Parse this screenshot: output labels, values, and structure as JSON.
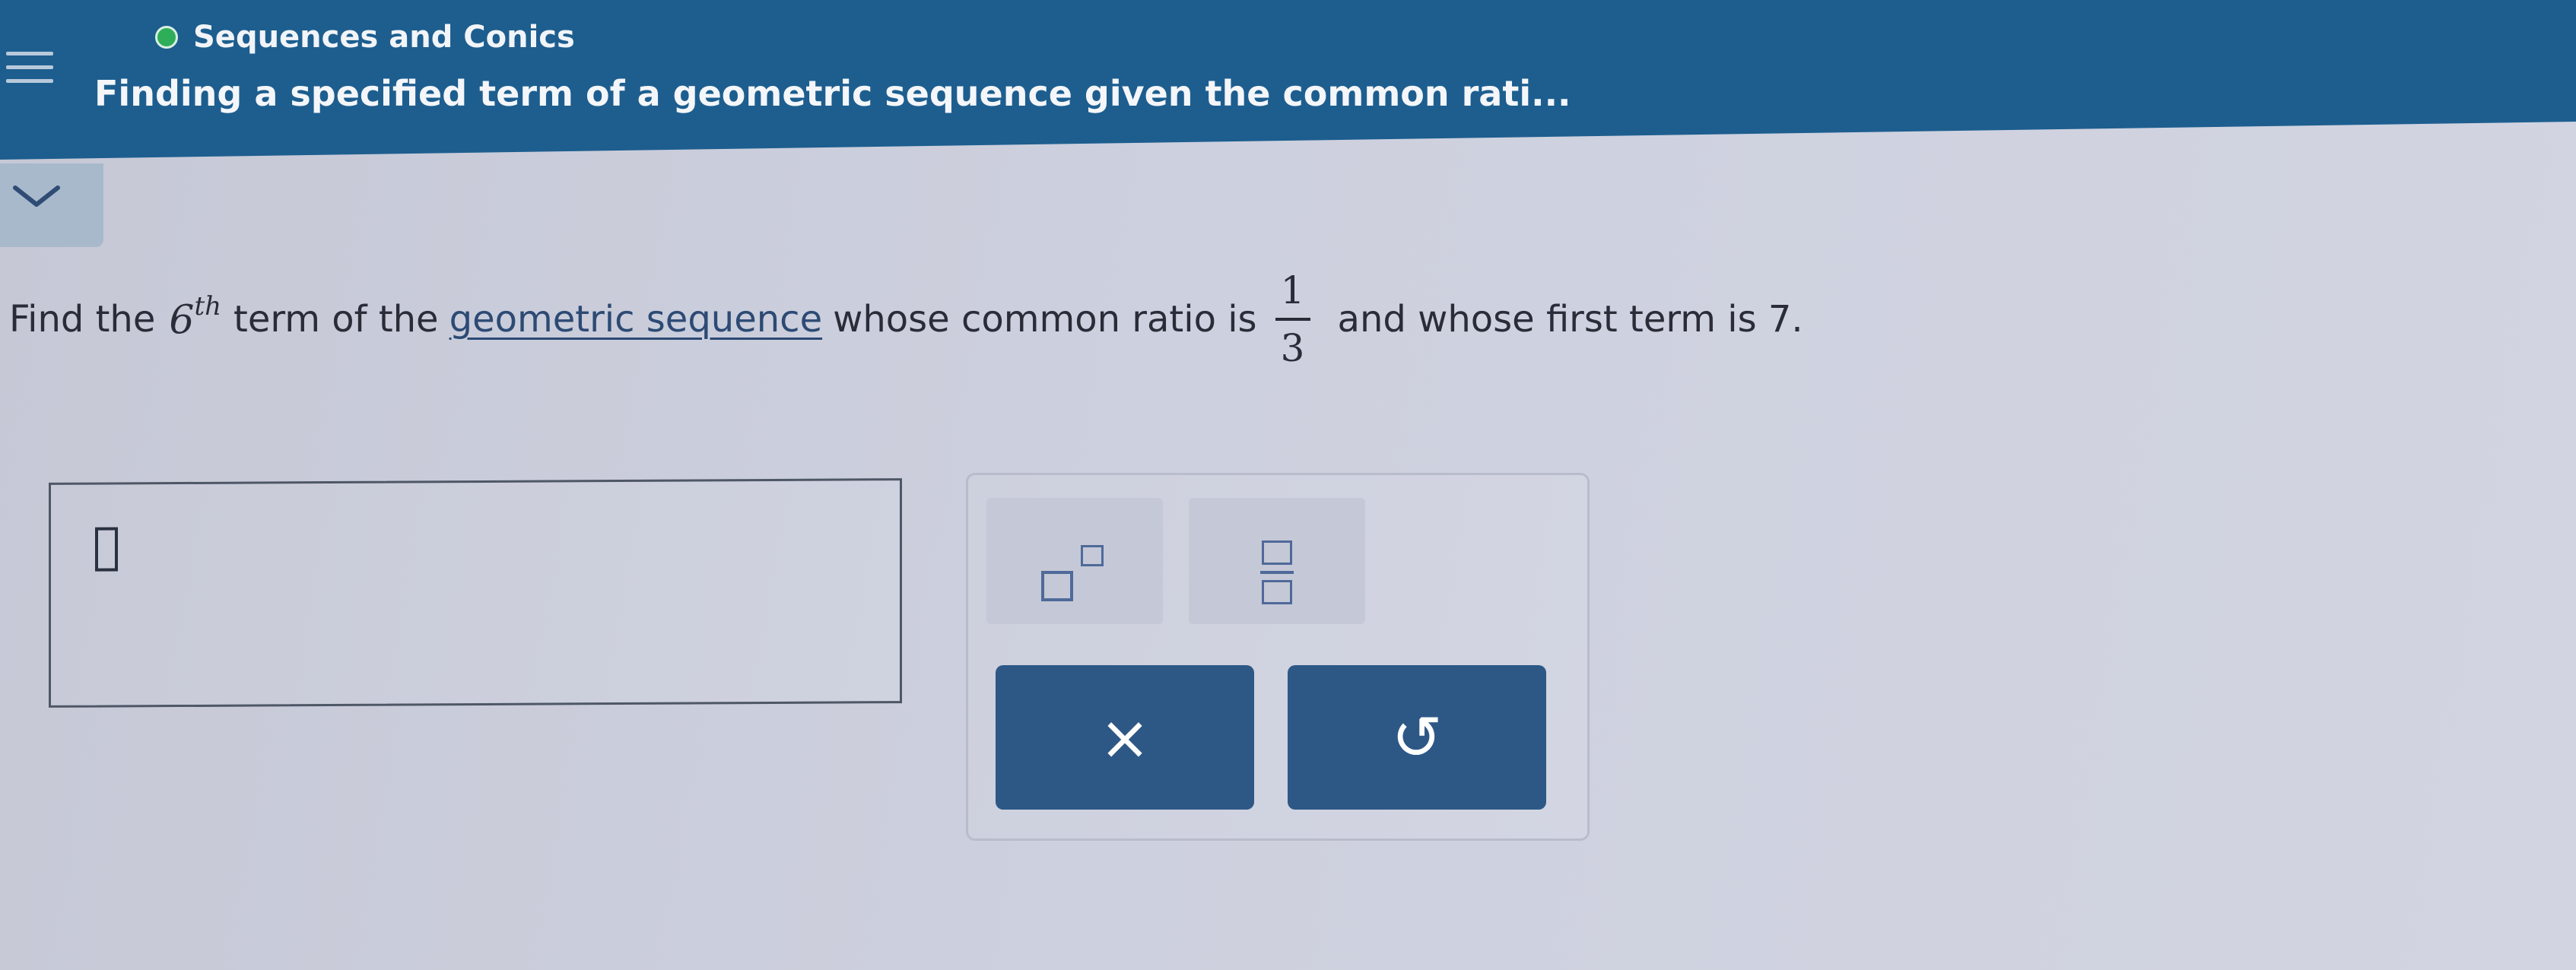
{
  "header": {
    "topic": "Sequences and Conics",
    "lesson_title": "Finding a specified term of a geometric sequence given the common rati..."
  },
  "question": {
    "part1": "Find the",
    "term_base": "6",
    "term_sup": "th",
    "part2": "term of the",
    "link_text": "geometric sequence",
    "part3": "whose common ratio is",
    "ratio_numerator": "1",
    "ratio_denominator": "3",
    "part4": "and whose first term is 7."
  },
  "keypad": {
    "clear_glyph": "×",
    "undo_glyph": "↺"
  },
  "colors": {
    "header_bg": "#1d5e8f",
    "status_dot": "#2fae5a",
    "key_dark": "#2d5886"
  },
  "icons": [
    "menu-icon",
    "status-dot-icon",
    "chevron-down-icon",
    "exponent-icon",
    "fraction-icon",
    "close-icon",
    "undo-icon"
  ]
}
